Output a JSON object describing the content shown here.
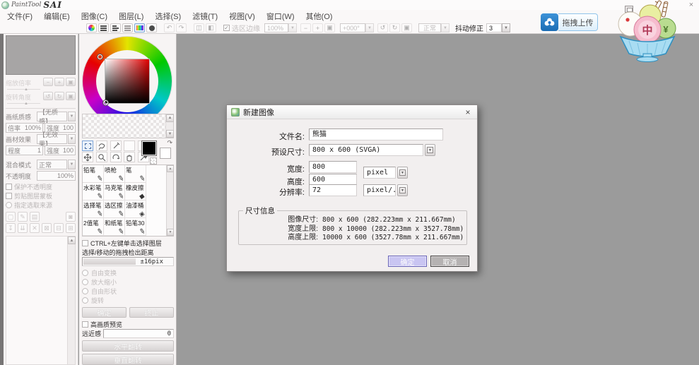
{
  "titlebar": {
    "logo_paint": "PaintTool",
    "logo_sai": "SAI",
    "close": "×"
  },
  "menu": {
    "items": [
      "文件(F)",
      "编辑(E)",
      "图像(C)",
      "图层(L)",
      "选择(S)",
      "滤镜(T)",
      "视图(V)",
      "窗口(W)",
      "其他(O)"
    ]
  },
  "toolbar": {
    "selection_edge": "选区边缘",
    "zoom_value": "100%",
    "angle_value": "+000°",
    "blend_value": "正常",
    "stabilizer_label": "抖动修正",
    "stabilizer_value": "3"
  },
  "navigator": {
    "zoom_label": "缩放倍率",
    "angle_label": "旋转角度"
  },
  "layer_panel": {
    "paper_label": "画纸质感",
    "paper_value": "【无质感】",
    "scale_label": "倍率",
    "scale_value": "100%",
    "strength_label": "强度",
    "strength_value": "100",
    "effect_label": "画材效果",
    "effect_value": "【无效果】",
    "degree_label": "程度",
    "degree_value": "1",
    "strength2_label": "强度",
    "strength2_value": "100",
    "blend_label": "混合模式",
    "blend_value": "正常",
    "opacity_label": "不透明度",
    "opacity_value": "100%",
    "check_protect": "保护不透明度",
    "check_clip": "剪贴图层蒙板",
    "radio_source": "指定选取来源"
  },
  "tools": {
    "brushes": [
      "铅笔",
      "喷枪",
      "笔",
      "水彩笔",
      "马克笔",
      "橡皮擦",
      "选择笔",
      "选区擦",
      "油漆桶",
      "2值笔",
      "和纸笔",
      "铅笔30"
    ]
  },
  "tool_options": {
    "ctrl_select": "CTRL+左键单击选择图层",
    "drag_detect": "选择/移动的拖拽检出距离",
    "drag_value": "±16pix",
    "radio_transform": "自由变换",
    "radio_scale": "放大缩小",
    "radio_freeform": "自由形状",
    "radio_rotate": "旋转",
    "confirm": "确定",
    "abort": "终止",
    "hq_preview": "高画质预览",
    "perspective_label": "远近感",
    "perspective_value": "0",
    "flip_h": "水平翻转",
    "flip_v": "垂直翻转"
  },
  "dialog": {
    "title": "新建图像",
    "close": "×",
    "filename_label": "文件名:",
    "filename_value": "熊猫",
    "preset_label": "预设尺寸:",
    "preset_value": " 800 x  600 (SVGA)",
    "width_label": "宽度:",
    "width_value": "800",
    "height_label": "高度:",
    "height_value": "600",
    "unit_value": "pixel",
    "resolution_label": "分辨率:",
    "resolution_value": "72",
    "resolution_unit": "pixel/...",
    "info_title": "尺寸信息",
    "info": [
      {
        "label": "图像尺寸:",
        "value": "800 x 600 (282.223mm x 211.667mm)"
      },
      {
        "label": "宽度上限:",
        "value": "800 x 10000 (282.223mm x 3527.78mm)"
      },
      {
        "label": "高度上限:",
        "value": "10000 x 600 (3527.78mm x 211.667mm)"
      }
    ],
    "ok": "确定",
    "cancel": "取消"
  },
  "overlay": {
    "upload": "拖拽上传",
    "scoop_center_char": "中",
    "scoop_right_char": "¥",
    "close": "×"
  },
  "colors": {
    "canvas": "#9b9b9b",
    "ok_button": "#c9c5f2",
    "cancel_button": "#b5b2b2",
    "upload_blue": "#2577c8",
    "selected_tool": "#7ea6d8"
  }
}
